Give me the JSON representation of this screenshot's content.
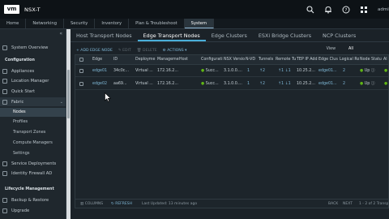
{
  "header": {
    "logo": "vm",
    "app_title": "NSX-T",
    "user": "admin",
    "icons": [
      "search-icon",
      "bell-icon",
      "help-icon",
      "apps-icon"
    ]
  },
  "nav": {
    "tabs": [
      {
        "label": "Home",
        "active": false
      },
      {
        "label": "Networking",
        "active": false
      },
      {
        "label": "Security",
        "active": false
      },
      {
        "label": "Inventory",
        "active": false
      },
      {
        "label": "Plan & Troubleshoot",
        "active": false
      },
      {
        "label": "System",
        "active": true
      }
    ]
  },
  "sidebar": {
    "collapse_glyph": "«",
    "overview": "System Overview",
    "configuration_heading": "Configuration",
    "items": [
      "Appliances",
      "Location Manager",
      "Quick Start",
      "Fabric"
    ],
    "fabric_sub": [
      "Nodes",
      "Profiles",
      "Transport Zones",
      "Compute Managers",
      "Settings"
    ],
    "more_items": [
      "Service Deployments",
      "Identity Firewall AD"
    ],
    "lifecycle_heading": "Lifecycle Management",
    "lifecycle_items": [
      "Backup & Restore",
      "Upgrade"
    ]
  },
  "subtabs": [
    {
      "label": "Host Transport Nodes",
      "active": false
    },
    {
      "label": "Edge Transport Nodes",
      "active": true
    },
    {
      "label": "Edge Clusters",
      "active": false
    },
    {
      "label": "ESXi Bridge Clusters",
      "active": false
    },
    {
      "label": "NCP Clusters",
      "active": false
    }
  ],
  "toolbar": {
    "add": "+ ADD EDGE NODE",
    "edit": "✎ EDIT",
    "delete": "🗑 DELETE",
    "actions": "⚙ ACTIONS ▾",
    "view_label": "View",
    "view_value": "All"
  },
  "table": {
    "columns": [
      "Edge",
      "ID",
      "Deployme",
      "Manageme",
      "Host",
      "Configurati",
      "NSX Versio",
      "N-VD",
      "Tunnels",
      "Remote Tu",
      "TEP IP Add",
      "Edge Clus",
      "Logical Ro",
      "Node Statu",
      "Al"
    ],
    "rows": [
      [
        "edge01",
        "34c0c...",
        "Virtual ...",
        "172.16.2...",
        "",
        "● Succ...",
        "3.1.0.0....",
        "1",
        "↑2",
        "↑1 ↓1",
        "10.25.2...",
        "edge01...",
        "2",
        "● Up ⓘ",
        "●"
      ],
      [
        "edge02",
        "aa69...",
        "Virtual ...",
        "172.16.2...",
        "",
        "● Succ...",
        "3.1.0.0....",
        "1",
        "↑2",
        "↑1 ↓1",
        "10.25.2...",
        "edge01...",
        "2",
        "● Up ⓘ",
        "●"
      ]
    ],
    "footer": {
      "columns": "COLUMNS",
      "refresh": "REFRESH",
      "last_updated": "Last Updated: 13 minutes ago",
      "back": "BACK",
      "next": "NEXT",
      "pager": "1 - 2 of 2 Transport"
    }
  },
  "colors": {
    "accent": "#49afd9",
    "link": "#7fb7d6",
    "success": "#60b515"
  }
}
